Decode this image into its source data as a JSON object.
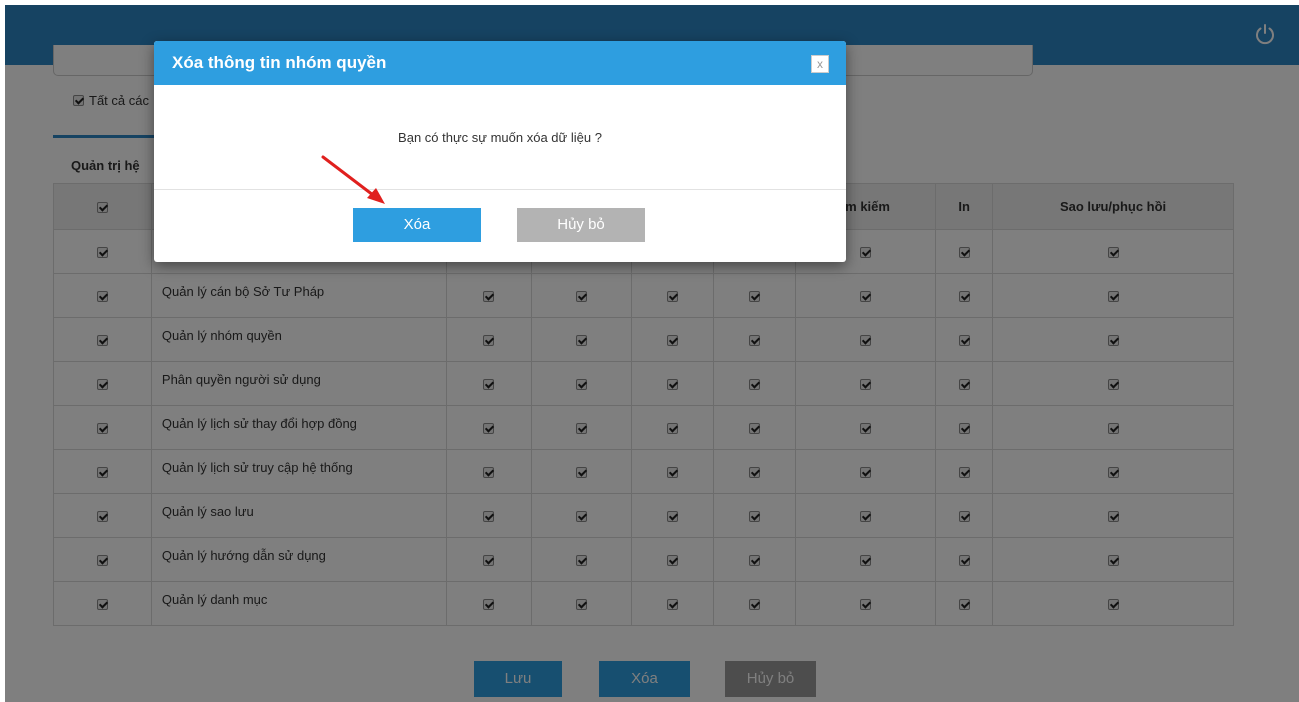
{
  "topbar": {
    "icon": "power-icon",
    "color": "#2c86c4"
  },
  "filters": {
    "all_check_label": "Tất cả các"
  },
  "tab": {
    "label": "Quản trị hệ"
  },
  "table": {
    "headers": [
      "",
      "",
      "",
      "",
      "",
      "",
      "ìm kiếm",
      "In",
      "Sao lưu/phục hồi"
    ],
    "rows": [
      {
        "name": ""
      },
      {
        "name": "Quản lý cán bộ Sở Tư Pháp"
      },
      {
        "name": "Quản lý nhóm quyền"
      },
      {
        "name": "Phân quyền người sử dụng"
      },
      {
        "name": "Quản lý lịch sử thay đổi hợp đồng"
      },
      {
        "name": "Quản lý lịch sử truy cập hệ thống"
      },
      {
        "name": "Quản lý sao lưu"
      },
      {
        "name": "Quản lý hướng dẫn sử dụng"
      },
      {
        "name": "Quản lý danh mục"
      }
    ]
  },
  "bottom_buttons": {
    "save": "Lưu",
    "delete": "Xóa",
    "cancel": "Hủy bỏ"
  },
  "modal": {
    "title": "Xóa thông tin nhóm quyền",
    "close": "x",
    "message": "Bạn có thực sự muốn xóa dữ liệu ?",
    "confirm": "Xóa",
    "cancel": "Hủy bỏ"
  },
  "colors": {
    "accent": "#2e9ee0",
    "arrow": "#e0201e"
  }
}
